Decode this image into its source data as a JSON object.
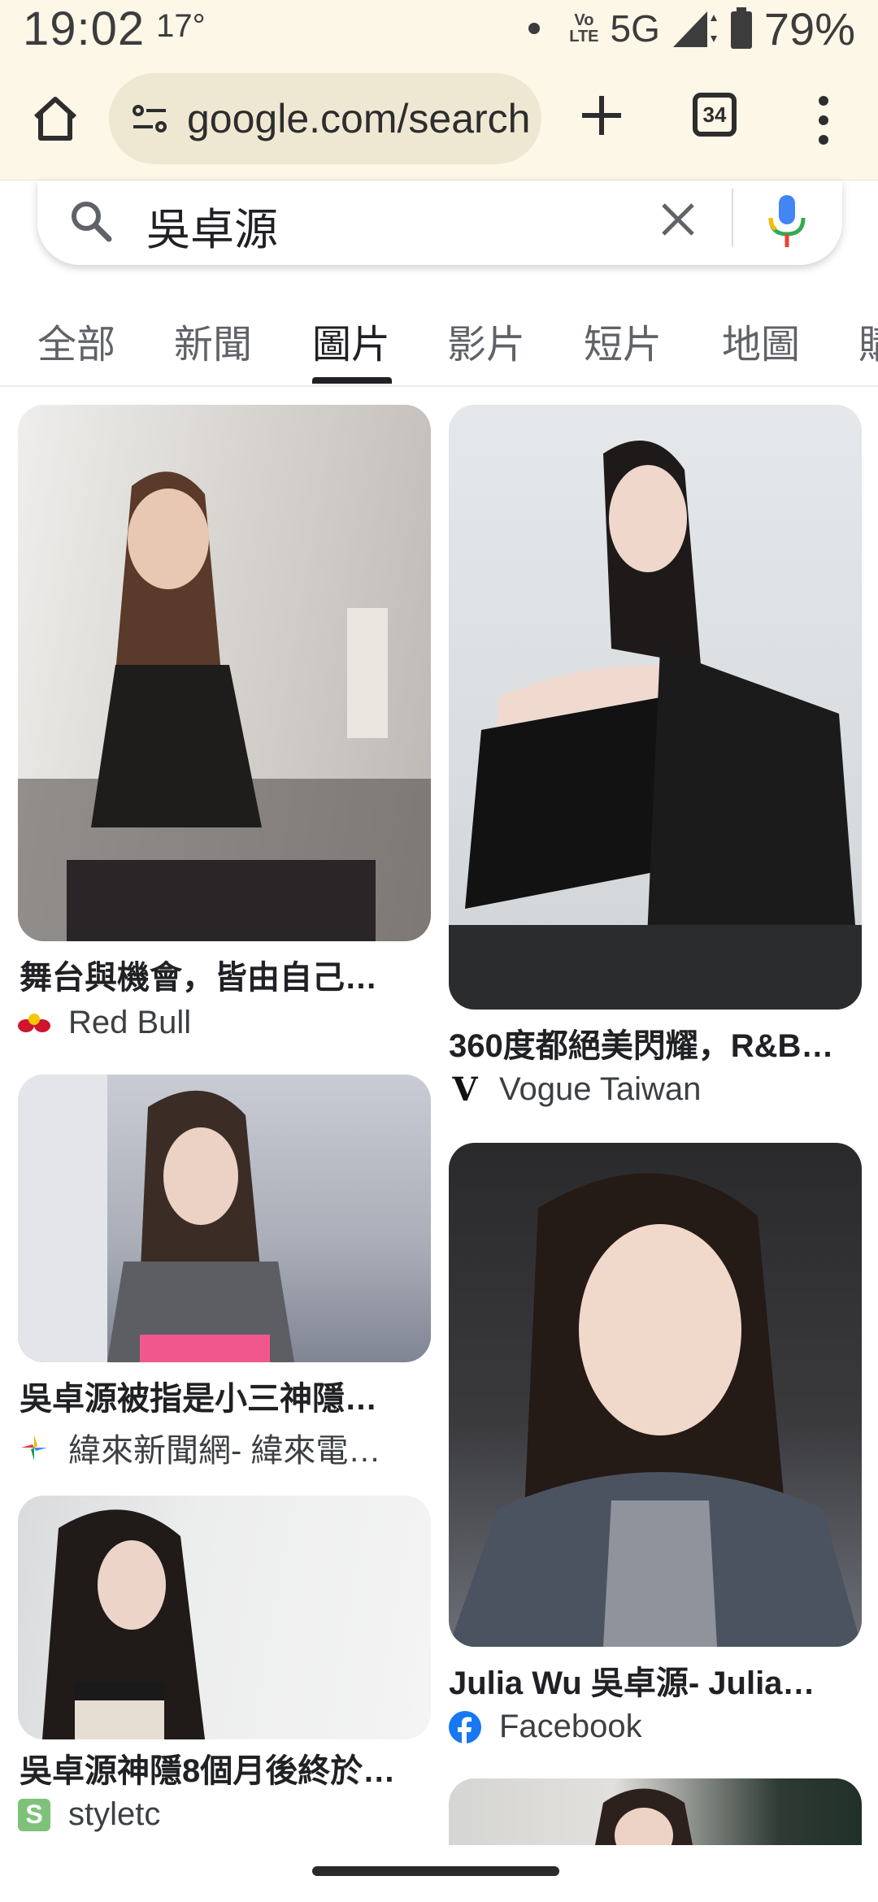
{
  "status_bar": {
    "time": "19:02",
    "temperature": "17°",
    "volte": [
      "Vo",
      "LTE"
    ],
    "network": "5G",
    "battery": "79%"
  },
  "browser": {
    "url": "google.com/search",
    "tab_count": "34"
  },
  "search": {
    "query": "吳卓源"
  },
  "tabs": [
    {
      "label": "全部"
    },
    {
      "label": "新聞"
    },
    {
      "label": "圖片"
    },
    {
      "label": "影片"
    },
    {
      "label": "短片"
    },
    {
      "label": "地圖"
    },
    {
      "label": "購"
    }
  ],
  "active_tab": "圖片",
  "results": [
    {
      "title": "舞台與機會，皆由自己…",
      "source": "Red Bull",
      "icon": "red-bull-icon"
    },
    {
      "title": "360度都絕美閃耀，R&B…",
      "source": "Vogue Taiwan",
      "icon": "vogue-icon"
    },
    {
      "title": "吳卓源被指是小三神隱…",
      "source": "緯來新聞網- 緯來電…",
      "icon": "videoland-icon"
    },
    {
      "title": "Julia Wu 吳卓源- Julia…",
      "source": "Facebook",
      "icon": "facebook-icon"
    },
    {
      "title": "吳卓源神隱8個月後終於…",
      "source": "styletc",
      "icon": "styletc-icon"
    }
  ],
  "colors": {
    "chrome_background": "#fdf7e8",
    "url_pill": "#eee8d3",
    "text_primary": "#202124",
    "text_secondary": "#5f6368",
    "facebook_blue": "#1877f2"
  }
}
